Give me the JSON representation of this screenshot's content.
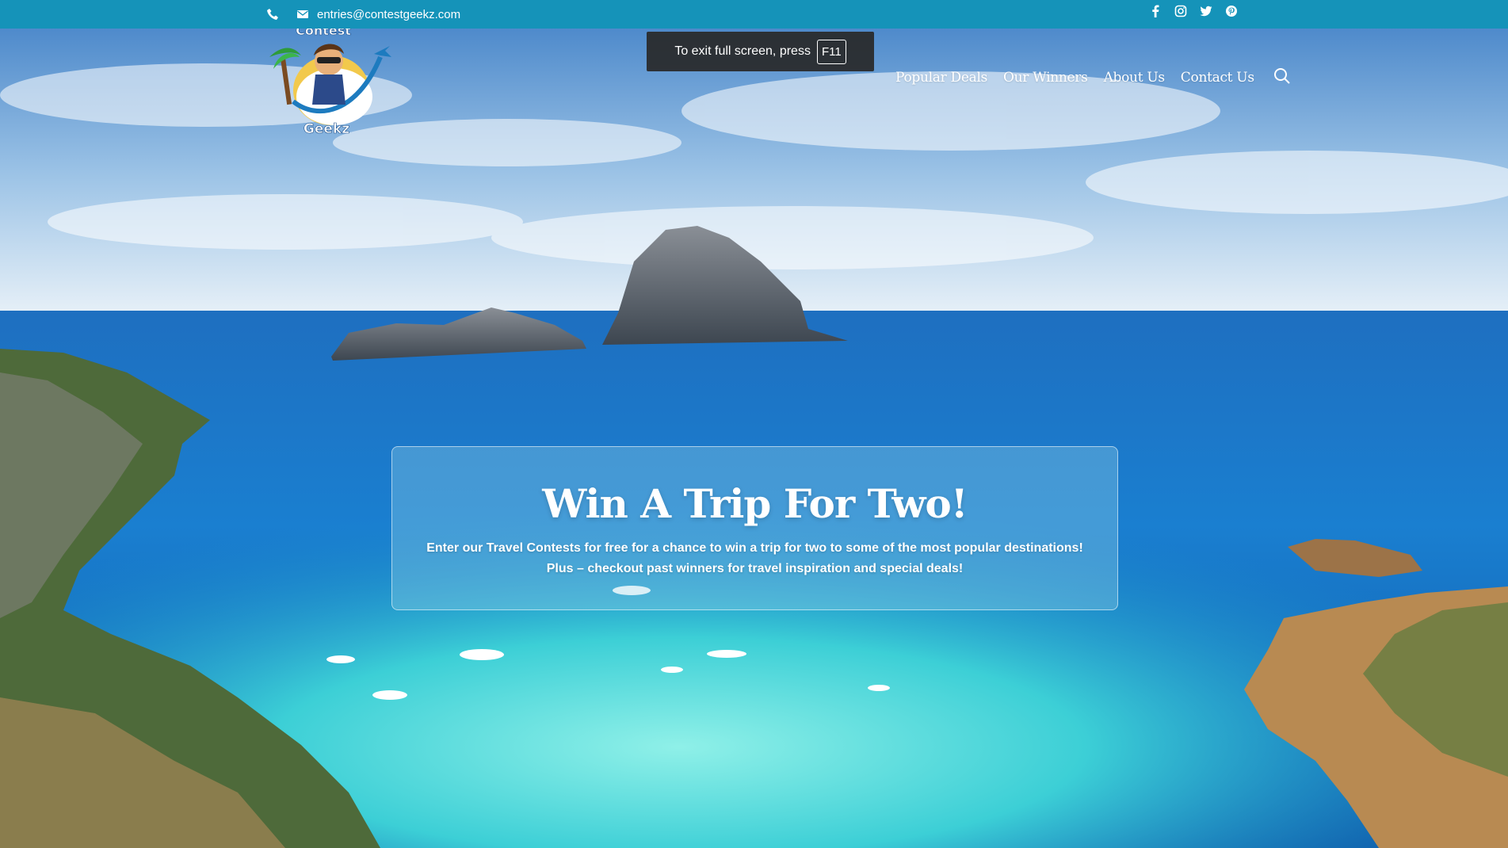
{
  "topbar": {
    "phone_icon": "phone-icon",
    "email_icon": "envelope-icon",
    "email": "entries@contestgeekz.com",
    "social": [
      "facebook-icon",
      "instagram-icon",
      "twitter-icon",
      "pinterest-icon"
    ]
  },
  "fullscreen_notice": {
    "text": "To exit full screen, press",
    "key": "F11"
  },
  "logo": {
    "top_text": "Contest",
    "bottom_text": "Geekz"
  },
  "nav": {
    "items": [
      "Popular Deals",
      "Our Winners",
      "About Us",
      "Contact Us"
    ],
    "search_icon": "search-icon"
  },
  "hero": {
    "title": "Win A Trip For Two!",
    "text": "Enter our Travel Contests for free for a chance to win a trip for two to some of the most popular destinations! Plus – checkout past winners for travel inspiration and special deals!"
  },
  "colors": {
    "topbar": "#1593b9",
    "sea_deep": "#1565b8",
    "sea_turquoise": "#3ec9d6",
    "sky": "#6aa3d8"
  }
}
